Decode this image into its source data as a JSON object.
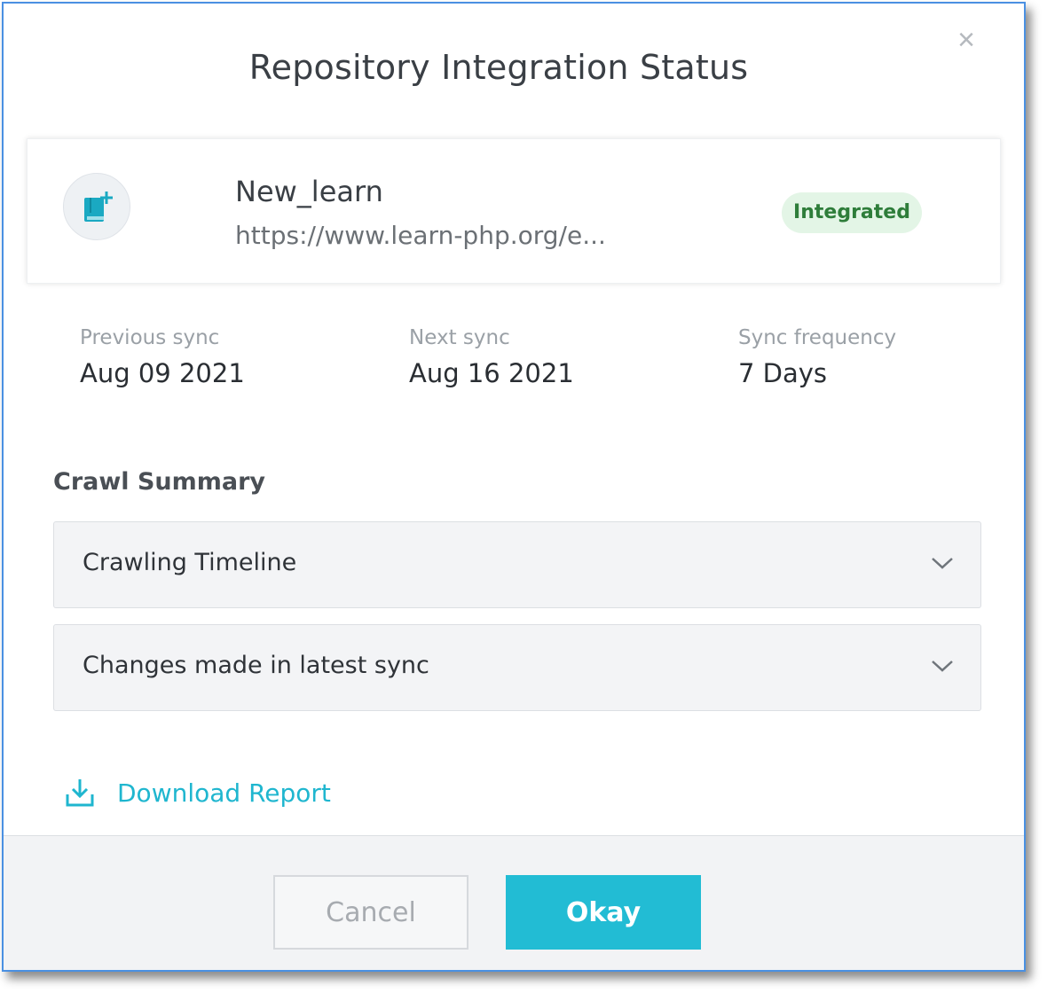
{
  "dialog": {
    "title": "Repository Integration Status",
    "close_icon": "close-icon"
  },
  "repository": {
    "icon": "book-add-icon",
    "name": "New_learn",
    "url": "https://www.learn-php.org/e...",
    "status": "Integrated",
    "status_color": "#2e7d3a"
  },
  "sync": {
    "previous_label": "Previous sync",
    "previous_value": "Aug 09 2021",
    "next_label": "Next sync",
    "next_value": "Aug 16 2021",
    "frequency_label": "Sync frequency",
    "frequency_value": "7 Days"
  },
  "crawl_summary": {
    "title": "Crawl Summary",
    "sections": [
      {
        "label": "Crawling Timeline",
        "icon": "chevron-down-icon"
      },
      {
        "label": "Changes made in latest sync",
        "icon": "chevron-down-icon"
      }
    ]
  },
  "download": {
    "icon": "download-icon",
    "label": "Download Report"
  },
  "footer": {
    "cancel_label": "Cancel",
    "okay_label": "Okay"
  },
  "colors": {
    "accent": "#22bcd4",
    "link": "#1fb6cf",
    "badge_bg": "#e3f5e6"
  }
}
